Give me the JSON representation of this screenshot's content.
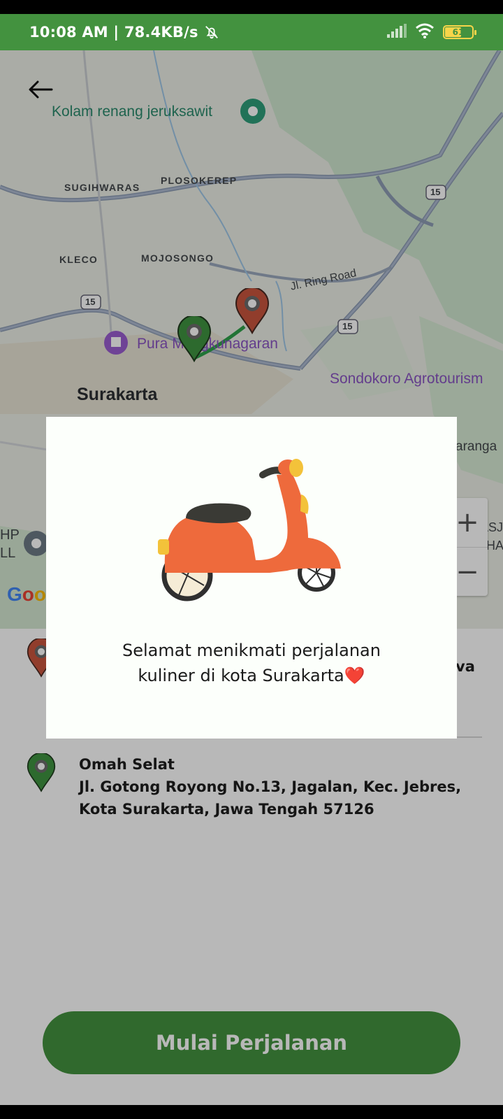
{
  "status_bar": {
    "time": "10:08 AM",
    "speed": "78.4KB/s",
    "battery": "61",
    "icons": [
      "bell-off-icon",
      "signal-icon",
      "wifi-icon",
      "battery-icon"
    ]
  },
  "map": {
    "labels": {
      "kolam": "Kolam renang jeruksawit",
      "sugihwaras": "SUGIHWARAS",
      "plosokerep": "PLOSOKEREP",
      "kleco": "KLECO",
      "mojosongo": "MOJOSONGO",
      "ring_road": "Jl. Ring Road",
      "road_15a": "15",
      "road_15b": "15",
      "road_15c": "15",
      "pura": "Pura Mangkunagaran",
      "sondokoro": "Sondokoro Agrotourism",
      "surakarta": "Surakarta",
      "karanga": "aranga",
      "hp": "HP",
      "ll": "LL",
      "masj": "MASJ",
      "muham": "MUHAM"
    },
    "zoom_in": "+",
    "zoom_out": "−",
    "google": "Goo"
  },
  "route": {
    "origin_fragment": "va",
    "destination_name": "Omah Selat",
    "destination_address_line1": "Jl. Gotong Royong No.13, Jagalan, Kec. Jebres,",
    "destination_address_line2": "Kota Surakarta, Jawa Tengah 57126"
  },
  "start_button": "Mulai Perjalanan",
  "dialog": {
    "line1": "Selamat menikmati perjalanan",
    "line2": "kuliner di kota Surakarta❤️"
  },
  "colors": {
    "brand_green": "#43923f",
    "pin_red": "#c9553e",
    "pin_green": "#3f9440",
    "scooter_orange": "#ee6a3c"
  }
}
